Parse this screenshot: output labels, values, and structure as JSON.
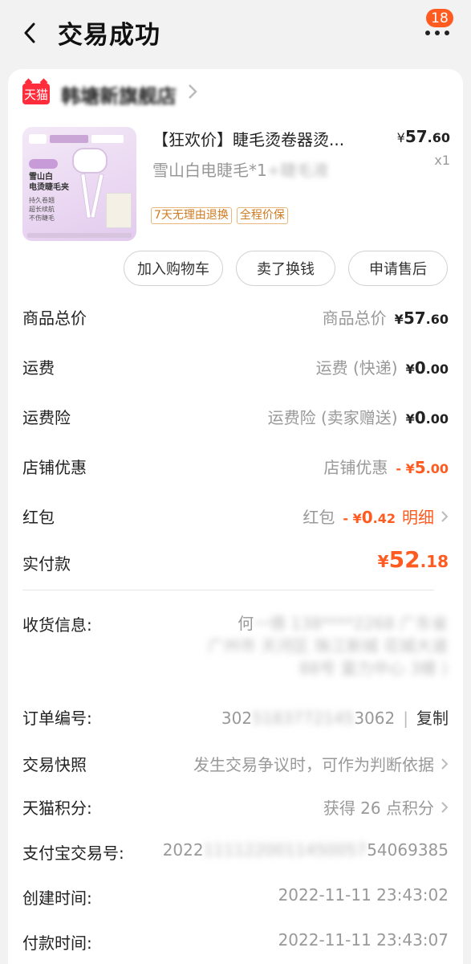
{
  "header": {
    "title": "交易成功",
    "badge_count": "18"
  },
  "shop": {
    "logo_text": "天猫",
    "name": "韩塘新旗舰店"
  },
  "product": {
    "title": "【狂欢价】睫毛烫卷器烫...",
    "price_symbol": "¥",
    "price_int": "57",
    "price_dec": ".60",
    "spec_visible": "雪山白电睫毛*1",
    "spec_blurred": "+睫毛液",
    "qty": "x1",
    "tags": [
      "7天无理由退换",
      "全程价保"
    ],
    "image_text": {
      "line1": "雪山白",
      "line2": "电烫睫毛夹",
      "list1": "持久卷翘",
      "list2": "超长续航",
      "list3": "不伤睫毛"
    }
  },
  "actions": {
    "add_cart": "加入购物车",
    "sell": "卖了换钱",
    "after_sale": "申请售后"
  },
  "summary": {
    "total": {
      "label": "商品总价",
      "sub": "商品总价",
      "sym": "¥",
      "int": "57",
      "dec": ".60"
    },
    "shipping": {
      "label": "运费",
      "sub": "运费 (快递)",
      "sym": "¥",
      "int": "0",
      "dec": ".00"
    },
    "insurance": {
      "label": "运费险",
      "sub": "运费险 (卖家赠送)",
      "sym": "¥",
      "int": "0",
      "dec": ".00"
    },
    "shop_discount": {
      "label": "店铺优惠",
      "sub": "店铺优惠",
      "sym": "- ¥",
      "int": "5",
      "dec": ".00"
    },
    "red_packet": {
      "label": "红包",
      "sub": "红包",
      "sym": "- ¥",
      "int": "0",
      "dec": ".42",
      "link": "明细"
    },
    "paid": {
      "label": "实付款",
      "sym": "¥",
      "int": "52",
      "dec": ".18"
    }
  },
  "address": {
    "label": "收货信息:",
    "line1_visible": "何",
    "line1_blurred": "一倩 138****2268 广东省",
    "line2_blurred": "广州市 天河区 珠江新城 花城大道",
    "line3_blurred": "88号 富力中心 3楼 )"
  },
  "info": {
    "order_no": {
      "label": "订单编号:",
      "visible_start": "302",
      "blurred": "5183772145",
      "visible_end": "3062",
      "sep": "|",
      "copy": "复制"
    },
    "snapshot": {
      "label": "交易快照",
      "value": "发生交易争议时，可作为判断依据"
    },
    "points": {
      "label": "天猫积分:",
      "value": "获得 26 点积分"
    },
    "alipay": {
      "label": "支付宝交易号:",
      "visible_start": "2022",
      "blurred": "1111220011450057",
      "visible_end": "54069385"
    },
    "created": {
      "label": "创建时间:",
      "value": "2022-11-11 23:43:02"
    },
    "paid_time": {
      "label": "付款时间:",
      "value": "2022-11-11 23:43:07"
    }
  },
  "colors": {
    "accent": "#ff5a1f",
    "tmall_red": "#ff2d3b",
    "tag_orange": "#d07a1e"
  },
  "icons": {
    "back": "chevron-left-icon",
    "more": "more-dots-icon",
    "chevron": "chevron-right-icon"
  }
}
